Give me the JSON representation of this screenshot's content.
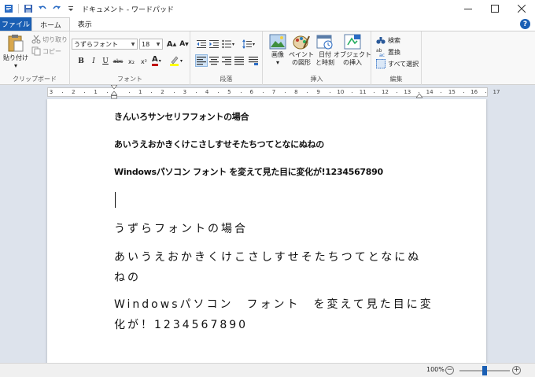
{
  "window": {
    "title": "ドキュメント - ワードパッド"
  },
  "tabs": {
    "file": "ファイル",
    "home": "ホーム",
    "view": "表示"
  },
  "clipboard": {
    "paste": "貼り付け",
    "cut": "切り取り",
    "copy": "コピー",
    "label": "クリップボード"
  },
  "font": {
    "family": "うずらフォント",
    "size": "18",
    "label": "フォント",
    "bold": "B",
    "italic": "I",
    "underline": "U",
    "strike": "abc",
    "subscript": "x₂",
    "superscript": "x²",
    "color_letter": "A"
  },
  "paragraph": {
    "label": "段落"
  },
  "insert": {
    "picture": "画像",
    "paint": "ペイント\nの図形",
    "datetime": "日付\nと時刻",
    "object": "オブジェクト\nの挿入",
    "label": "挿入"
  },
  "editing": {
    "find": "検索",
    "replace": "置換",
    "select_all": "すべて選択",
    "label": "編集"
  },
  "ruler": {
    "labels": [
      "3",
      "2",
      "1",
      "",
      "1",
      "2",
      "3",
      "4",
      "5",
      "6",
      "7",
      "8",
      "9",
      "10",
      "11",
      "12",
      "13",
      "14",
      "15",
      "16",
      "17"
    ]
  },
  "document": {
    "lines": [
      "きんいろサンセリフフォントの場合",
      "あいうえおかきくけこさしすせそたちつてとなにぬねの",
      "Windowsパソコン フォント を変えて見た目に変化が!1234567890",
      "うずらフォントの場合",
      "あいうえおかきくけこさしすせそたちつてとなにぬ",
      "ねの",
      "Windowsパソコン　フォント　を変えて見た目に変",
      "化が！1234567890"
    ]
  },
  "status": {
    "zoom": "100%",
    "zoom_level": 0.5
  },
  "colors": {
    "accent": "#1a5fb4",
    "font_color": "#c00000",
    "highlight": "#ffff00"
  }
}
